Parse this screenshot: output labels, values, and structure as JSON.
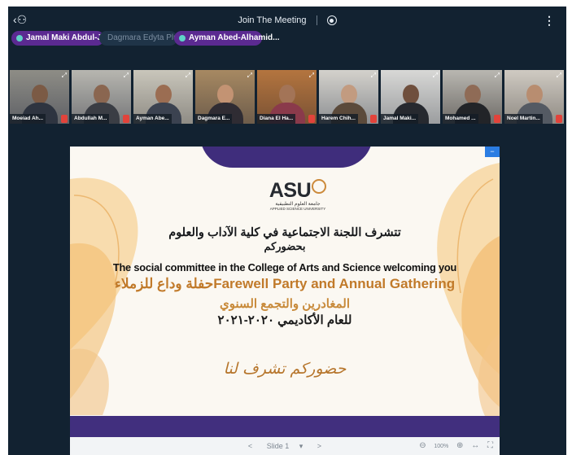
{
  "header": {
    "title": "Join The Meeting",
    "people_icon": "people-icon",
    "record_icon": "record-icon",
    "more_icon": "more-vertical-icon"
  },
  "presenters": [
    {
      "name": "Jamal Maki Abdul-Ja...",
      "active": true
    },
    {
      "name": "Dagmara Edyta Pluta",
      "active": false
    },
    {
      "name": "Ayman Abed-Alhamid...",
      "active": true
    }
  ],
  "participants": [
    {
      "name": "Moeiad Ah...",
      "muted": true
    },
    {
      "name": "Abdullah M...",
      "muted": true
    },
    {
      "name": "Ayman Abe...",
      "muted": false
    },
    {
      "name": "Dagmara E...",
      "muted": false
    },
    {
      "name": "Diana El Ha...",
      "muted": true
    },
    {
      "name": "Harem Chih...",
      "muted": true
    },
    {
      "name": "Jamal Maki...",
      "muted": false
    },
    {
      "name": "Mohamed ...",
      "muted": true
    },
    {
      "name": "Noel Martin...",
      "muted": true
    }
  ],
  "slide": {
    "logo_text": "ASU",
    "logo_arabic": "جامعة العلوم التطبيقية",
    "logo_english": "APPLIED SCIENCE UNIVERSITY",
    "line1": "تتشرف اللجنة الاجتماعية في كلية الآداب والعلوم",
    "line2": "بحضوركم",
    "line3": "The social committee in  the College of Arts and Science welcoming you",
    "line4": "حفلة وداع للزملاءFarewell Party and Annual Gathering",
    "line5": "المغادرين والتجمع السنوي",
    "line6": "للعام الأكاديمي ٢٠٢٠-٢٠٢١",
    "line7": "حضوركم تشرف لنا",
    "corner_label": "−"
  },
  "controls": {
    "prev": "<",
    "slide_label": "Slide 1",
    "dropdown": "▾",
    "next": ">",
    "zoom_out": "⊖",
    "zoom_level": "100%",
    "zoom_in": "⊕",
    "fit_width": "↔",
    "fullscreen": "⛶"
  },
  "colors": {
    "background": "#122231",
    "presenter_chip": "#5b2a91",
    "slide_accent": "#412f7e",
    "active_outline": "#2c7de6",
    "mute_badge": "#e2433b"
  }
}
